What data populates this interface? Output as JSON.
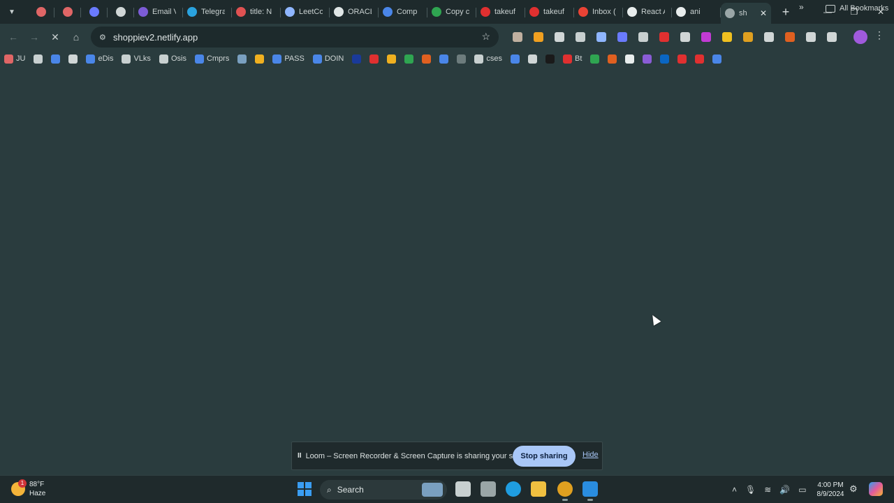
{
  "browser": {
    "tabs": [
      {
        "label": "",
        "fav_color": "#e06666",
        "kind": "pinned"
      },
      {
        "label": "",
        "fav_color": "#e06666",
        "kind": "pinned"
      },
      {
        "label": "",
        "fav_color": "#6a7bff",
        "kind": "pinned"
      },
      {
        "label": "",
        "fav_color": "#d0d6d6",
        "kind": "pinned"
      },
      {
        "label": "Email V",
        "fav_color": "#7c5cd6",
        "kind": "normal"
      },
      {
        "label": "Telegra",
        "fav_color": "#2aa3df",
        "kind": "normal"
      },
      {
        "label": "title: N",
        "fav_color": "#e05252",
        "kind": "normal"
      },
      {
        "label": "LeetCo",
        "fav_color": "#8fb6ff",
        "kind": "normal"
      },
      {
        "label": "ORACL",
        "fav_color": "#e0e6e6",
        "kind": "normal"
      },
      {
        "label": "Comp",
        "fav_color": "#4a86e8",
        "kind": "normal"
      },
      {
        "label": "Copy c",
        "fav_color": "#2fa551",
        "kind": "normal"
      },
      {
        "label": "takeuf",
        "fav_color": "#e03030",
        "kind": "normal"
      },
      {
        "label": "takeuf",
        "fav_color": "#e03030",
        "kind": "normal"
      },
      {
        "label": "Inbox (",
        "fav_color": "#ea4335",
        "kind": "normal"
      },
      {
        "label": "React A",
        "fav_color": "#e8eded",
        "kind": "normal"
      },
      {
        "label": "ani",
        "fav_color": "#e8eded",
        "kind": "normal"
      },
      {
        "label": "sh",
        "fav_color": "#9aa6a7",
        "kind": "active"
      }
    ],
    "new_tab_glyph": "+",
    "url": "shoppiev2.netlify.app",
    "extension_colors": [
      "#c0b0a0",
      "#f0a020",
      "#d0d6d6",
      "#c8d0d0",
      "#8fb6ff",
      "#6a7bff",
      "#c8d0d0",
      "#e03030",
      "#d0d6d6",
      "#c23bd4",
      "#f0c020",
      "#e0a020",
      "#d0d6d6",
      "#e06020",
      "#d0d6d6",
      "#d0d6d6"
    ]
  },
  "bookmarks": {
    "items": [
      {
        "label": "JU",
        "fav_color": "#e06666"
      },
      {
        "label": "",
        "fav_color": "#c8d0d0"
      },
      {
        "label": "",
        "fav_color": "#4a86e8"
      },
      {
        "label": "",
        "fav_color": "#d0d6d6"
      },
      {
        "label": "eDis",
        "fav_color": "#4a86e8"
      },
      {
        "label": "VLks",
        "fav_color": "#c8d0d0"
      },
      {
        "label": "Osis",
        "fav_color": "#c8d0d0"
      },
      {
        "label": "Cmprs",
        "fav_color": "#4a86e8"
      },
      {
        "label": "",
        "fav_color": "#7aa0c0"
      },
      {
        "label": "",
        "fav_color": "#f0b020"
      },
      {
        "label": "PASS",
        "fav_color": "#4a86e8"
      },
      {
        "label": "DOIN",
        "fav_color": "#4a86e8"
      },
      {
        "label": "",
        "fav_color": "#1a3a9a"
      },
      {
        "label": "",
        "fav_color": "#e03030"
      },
      {
        "label": "",
        "fav_color": "#f0b020"
      },
      {
        "label": "",
        "fav_color": "#2fa551"
      },
      {
        "label": "",
        "fav_color": "#e06020"
      },
      {
        "label": "",
        "fav_color": "#4a86e8"
      },
      {
        "label": "",
        "fav_color": "#6d7c7d"
      },
      {
        "label": "cses",
        "fav_color": "#c8d0d0"
      },
      {
        "label": "",
        "fav_color": "#4a86e8"
      },
      {
        "label": "",
        "fav_color": "#d0d6d6"
      },
      {
        "label": "",
        "fav_color": "#1a1a1a"
      },
      {
        "label": "Bt",
        "fav_color": "#e03030"
      },
      {
        "label": "",
        "fav_color": "#2fa551"
      },
      {
        "label": "",
        "fav_color": "#e06020"
      },
      {
        "label": "",
        "fav_color": "#e8eded"
      },
      {
        "label": "",
        "fav_color": "#8a5cd6"
      },
      {
        "label": "",
        "fav_color": "#0a66c2"
      },
      {
        "label": "",
        "fav_color": "#e03030"
      },
      {
        "label": "",
        "fav_color": "#e03030"
      },
      {
        "label": "",
        "fav_color": "#4a86e8"
      }
    ],
    "more_glyph": "»",
    "all_bookmarks_label": "All Bookmarks"
  },
  "loom": {
    "message": "Loom – Screen Recorder & Screen Capture is sharing your screen.",
    "stop_label": "Stop sharing",
    "hide_label": "Hide",
    "pause_glyph": "II"
  },
  "taskbar": {
    "weather_temp": "88°F",
    "weather_desc": "Haze",
    "weather_badge": "1",
    "search_label": "Search",
    "apps": [
      {
        "name": "task-view",
        "color": "#c8d0d0"
      },
      {
        "name": "settings",
        "color": "#9aa6a7"
      },
      {
        "name": "edge",
        "color": "#1f9de0"
      },
      {
        "name": "file-explorer",
        "color": "#f0c040"
      },
      {
        "name": "chrome",
        "color": "#e0a020"
      },
      {
        "name": "vscode",
        "color": "#2a8de0"
      }
    ],
    "time": "4:00 PM",
    "date": "8/9/2024"
  },
  "colors": {
    "page_bg": "#2a3c3e",
    "tabstrip_bg": "#1e2a2c",
    "accent": "#a9c7f7"
  }
}
